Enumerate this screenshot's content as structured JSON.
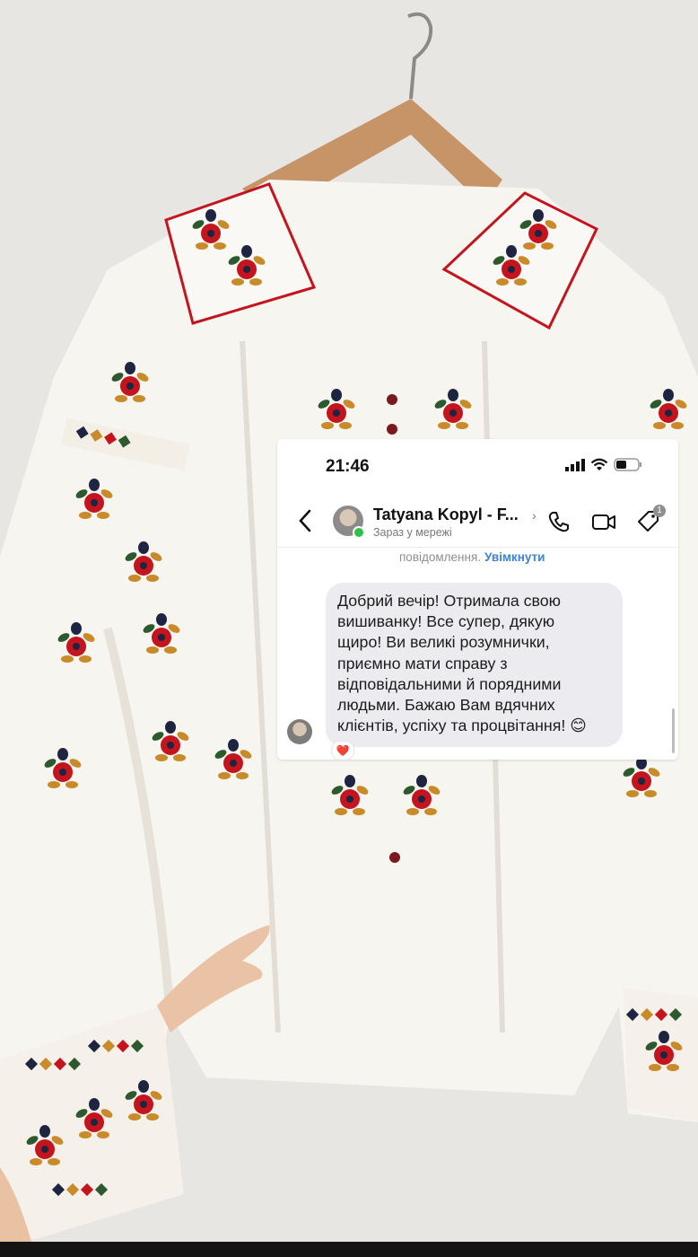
{
  "status_bar": {
    "time": "21:46"
  },
  "header": {
    "contact_name": "Tatyana Kopyl - F...",
    "presence": "Зараз у мережі",
    "tag_badge": "1"
  },
  "notice": {
    "text": "повідомлення.",
    "action": "Увімкнути"
  },
  "message": {
    "lines": [
      "Добрий вечір! Отримала свою",
      "вишиванку! Все супер, дякую",
      "щиро! Ви великі розумнички,",
      "приємно мати справу з",
      "відповідальними й порядними",
      "людьми. Бажаю Вам вдячних",
      "клієнтів, успіху та процвітання! 😊"
    ],
    "reaction": "❤️"
  },
  "colors": {
    "accent": "#3b82d6",
    "bubble": "#ececf0",
    "online": "#2dc24a",
    "embroidery_red": "#c4151f",
    "embroidery_navy": "#1d2541",
    "embroidery_green": "#2c5a2e",
    "embroidery_gold": "#c98a2a"
  }
}
